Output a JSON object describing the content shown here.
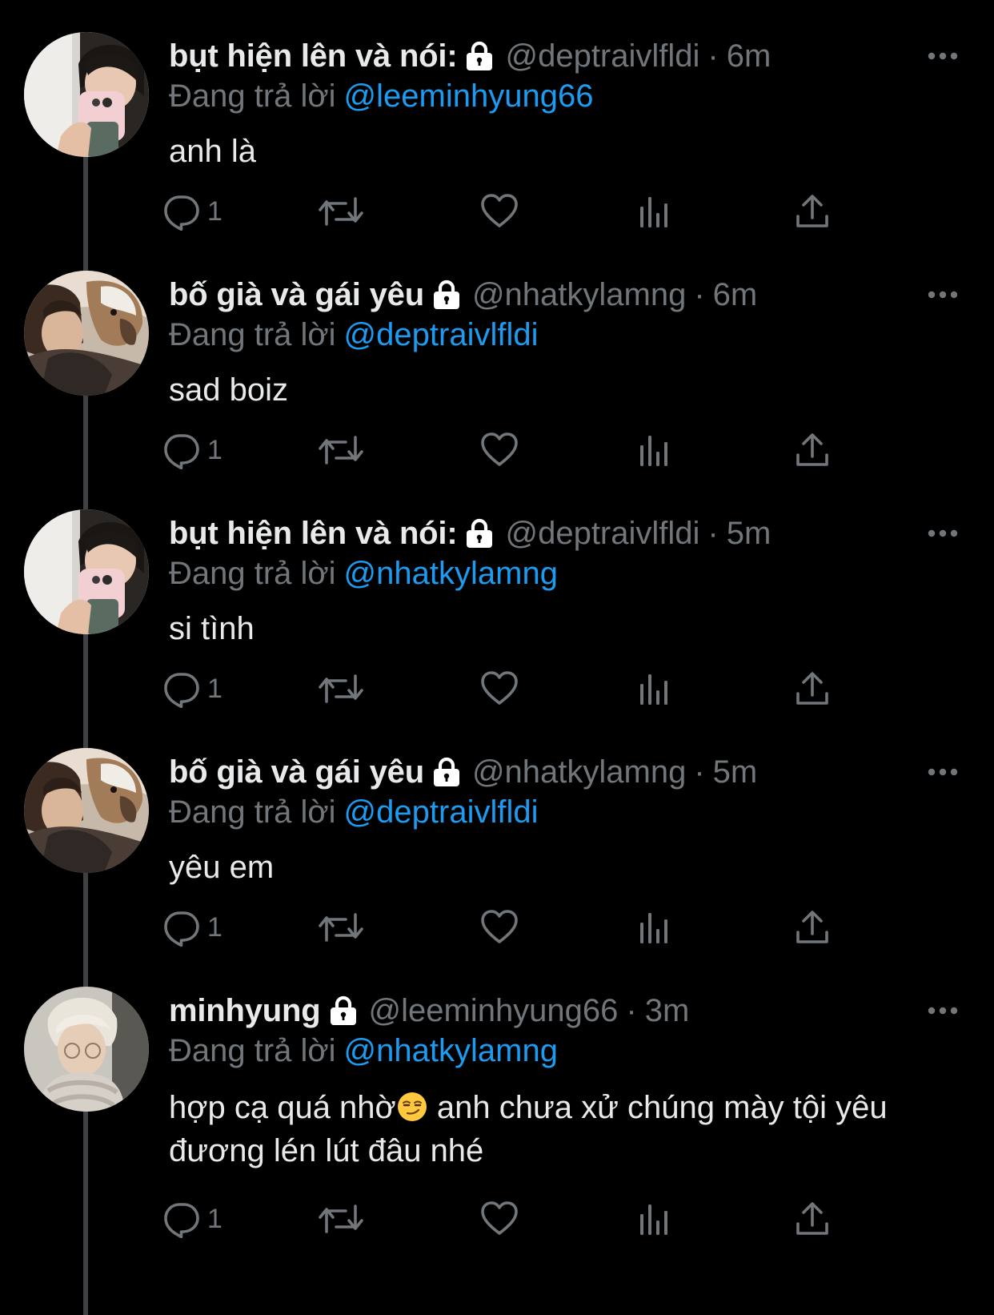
{
  "colors": {
    "background": "#000000",
    "text_primary": "#e7e9ea",
    "text_secondary": "#71767b",
    "accent": "#1d9bf0",
    "thread_line": "#3e4144"
  },
  "tweets": [
    {
      "display_name": "bụt hiện lên và nói:",
      "handle": "@deptraivlfldi",
      "separator": "·",
      "time": "6m",
      "reply_prefix": "Đang trả lời",
      "reply_to": "@leeminhyung66",
      "text": "anh là",
      "reply_count": "1",
      "avatar": "avatar-deptraivlfldi",
      "locked": true
    },
    {
      "display_name": "bố già và gái yêu",
      "handle": "@nhatkylamng",
      "separator": "·",
      "time": "6m",
      "reply_prefix": "Đang trả lời",
      "reply_to": "@deptraivlfldi",
      "text": "sad boiz",
      "reply_count": "1",
      "avatar": "avatar-nhatkylamng",
      "locked": true
    },
    {
      "display_name": "bụt hiện lên và nói:",
      "handle": "@deptraivlfldi",
      "separator": "·",
      "time": "5m",
      "reply_prefix": "Đang trả lời",
      "reply_to": "@nhatkylamng",
      "text": "si tình",
      "reply_count": "1",
      "avatar": "avatar-deptraivlfldi",
      "locked": true
    },
    {
      "display_name": "bố già và gái yêu",
      "handle": "@nhatkylamng",
      "separator": "·",
      "time": "5m",
      "reply_prefix": "Đang trả lời",
      "reply_to": "@deptraivlfldi",
      "text": "yêu em",
      "reply_count": "1",
      "avatar": "avatar-nhatkylamng",
      "locked": true
    },
    {
      "display_name": "minhyung",
      "handle": "@leeminhyung66",
      "separator": "·",
      "time": "3m",
      "reply_prefix": "Đang trả lời",
      "reply_to": "@nhatkylamng",
      "text_part1": "hợp cạ quá nhờ",
      "emoji": "smirk-emoji",
      "text_part2": " anh chưa xử chúng mày tội yêu đương lén lút đâu nhé",
      "reply_count": "1",
      "avatar": "avatar-leeminhyung66",
      "locked": true
    }
  ],
  "action_icons": [
    "reply-icon",
    "retweet-icon",
    "like-icon",
    "analytics-icon",
    "share-icon"
  ],
  "header_icons": [
    "lock-icon",
    "more-icon"
  ]
}
